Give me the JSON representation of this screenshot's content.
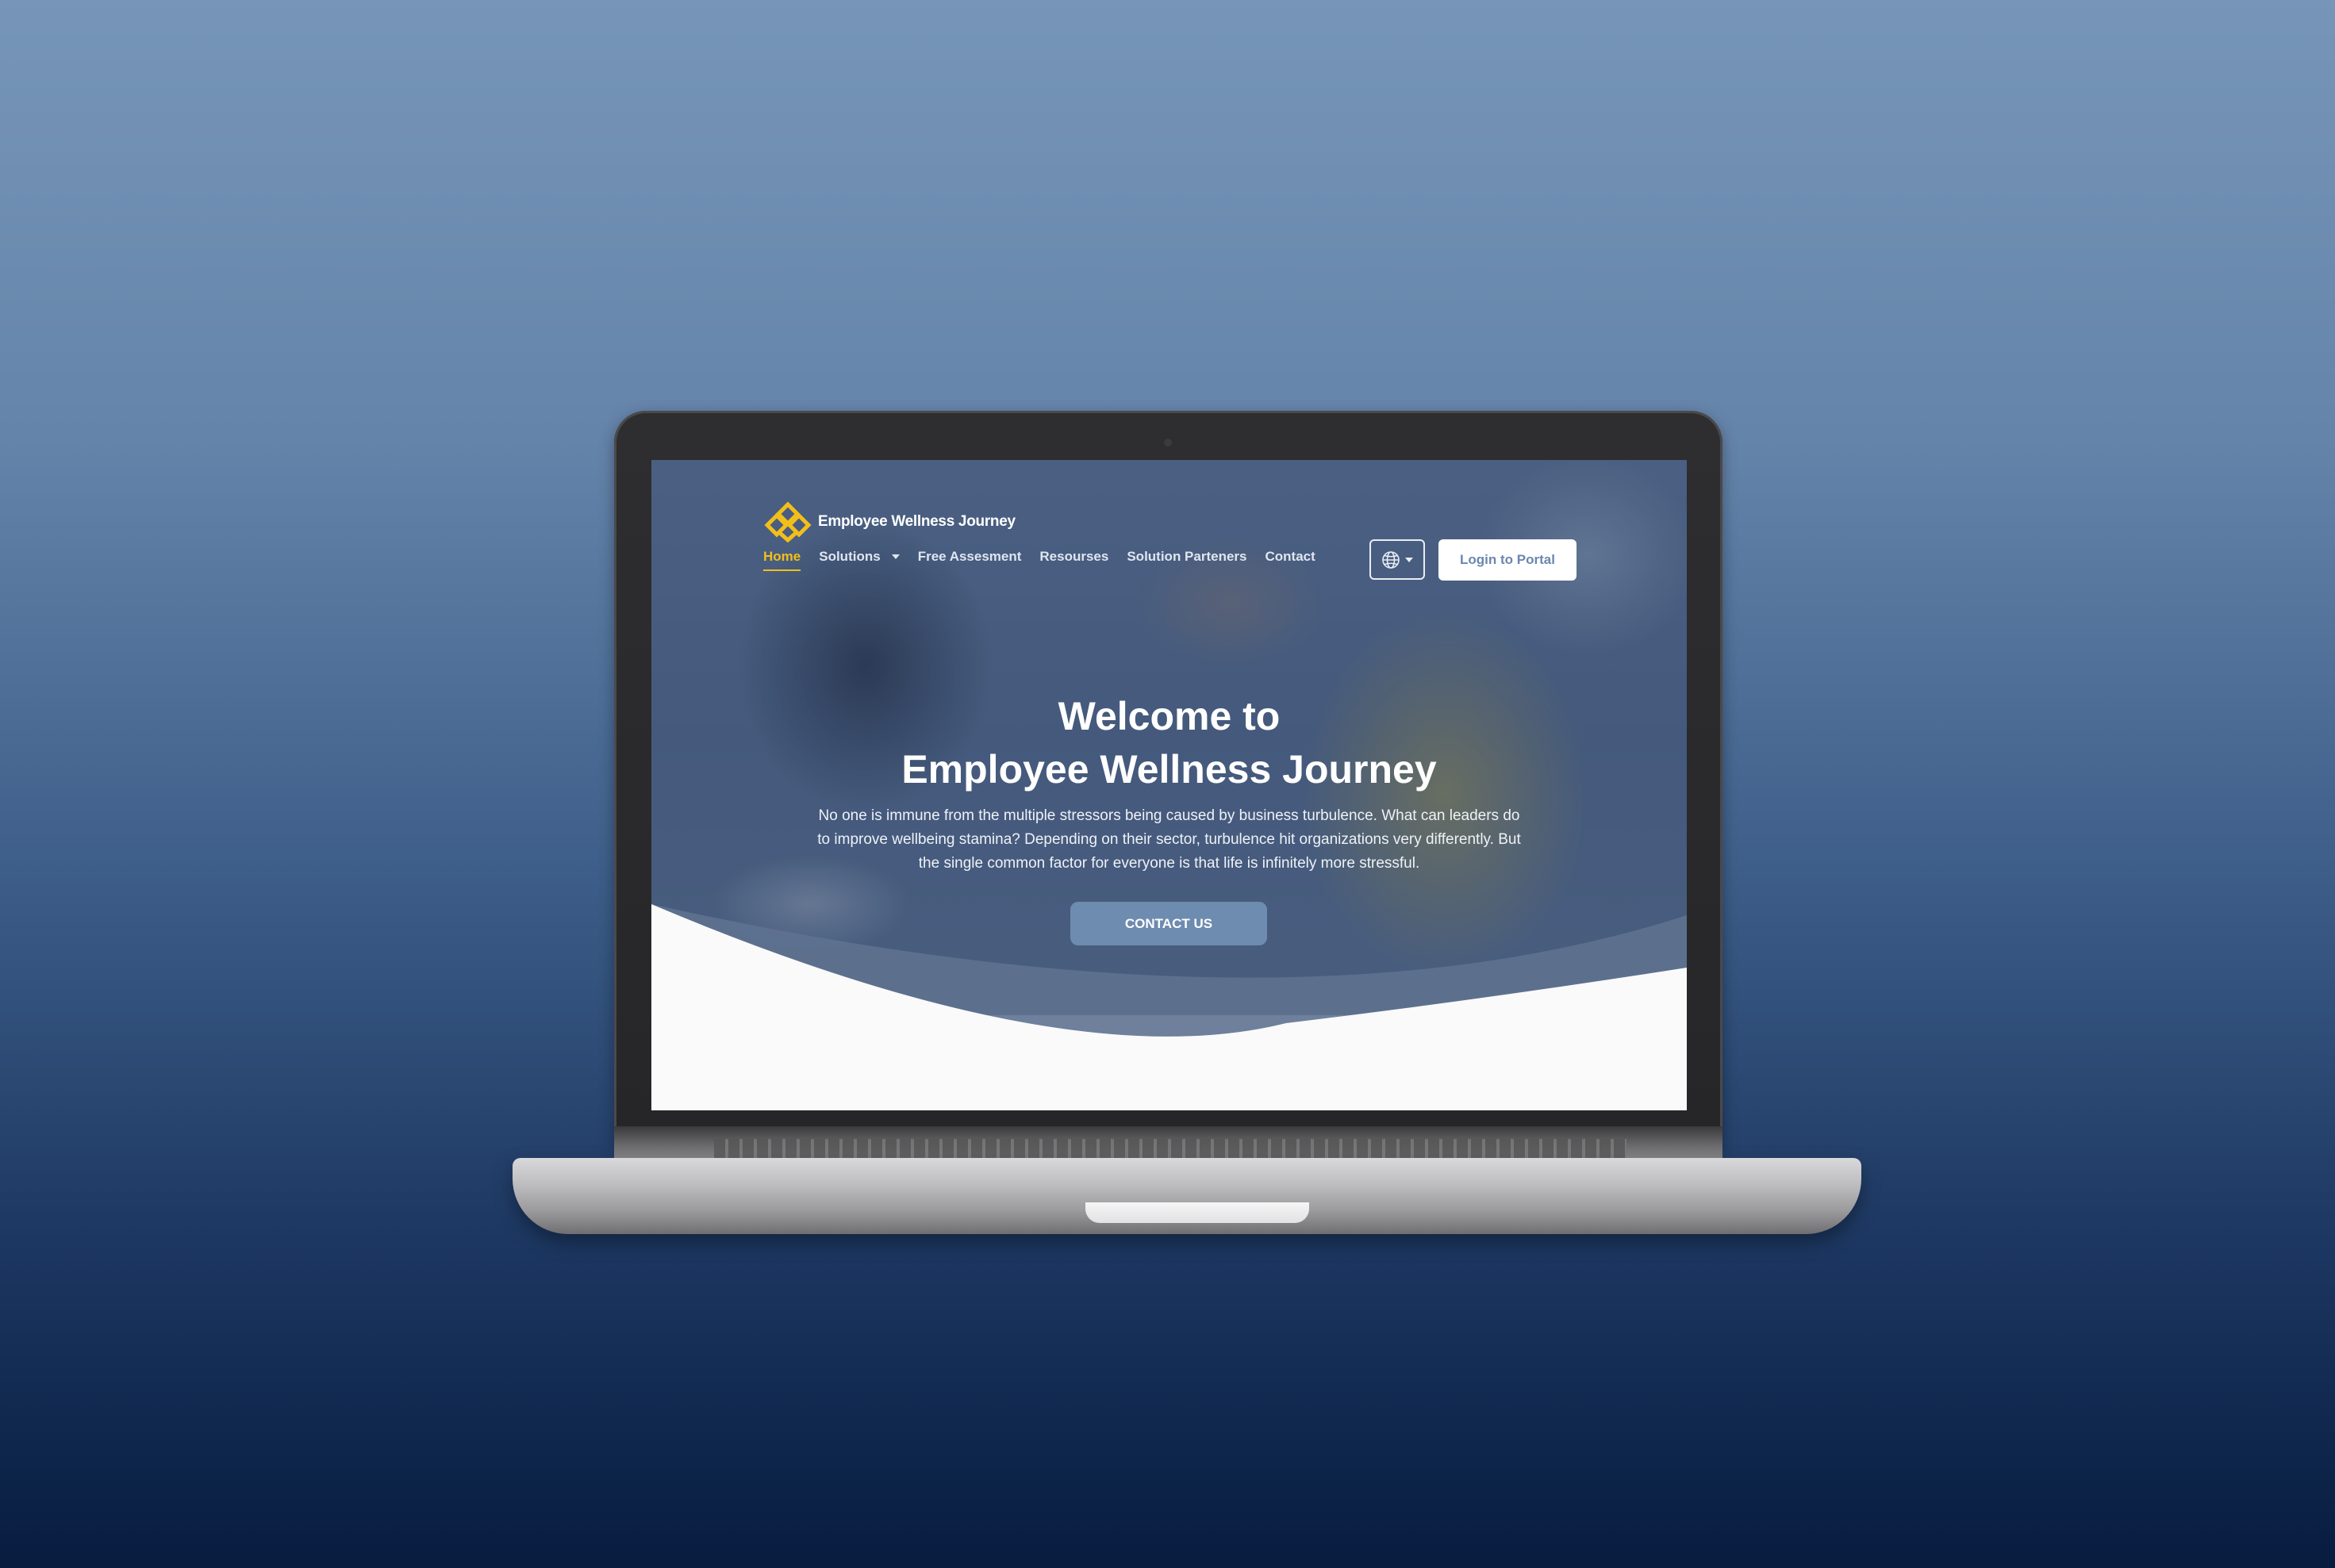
{
  "site": {
    "brand_name": "Employee Wellness Journey",
    "logo_icon": "diamond-knot-logo-icon",
    "accent_color": "#f2bf1a",
    "primary_color": "#6e8bb0"
  },
  "nav": {
    "items": [
      {
        "label": "Home",
        "active": true
      },
      {
        "label": "Solutions",
        "has_dropdown": true
      },
      {
        "label": "Free Assesment"
      },
      {
        "label": "Resourses"
      },
      {
        "label": "Solution Parteners"
      },
      {
        "label": "Contact"
      }
    ],
    "language_icon": "globe-icon",
    "login_label": "Login to Portal"
  },
  "hero": {
    "title_line1": "Welcome to",
    "title_line2": "Employee Wellness Journey",
    "body": "No one is immune from the multiple stressors being caused by business turbulence. What can leaders do to improve wellbeing stamina? Depending on their sector, turbulence hit organizations very differently. But the single common factor for everyone is that life is infinitely more stressful.",
    "cta_label": "CONTACT US"
  }
}
